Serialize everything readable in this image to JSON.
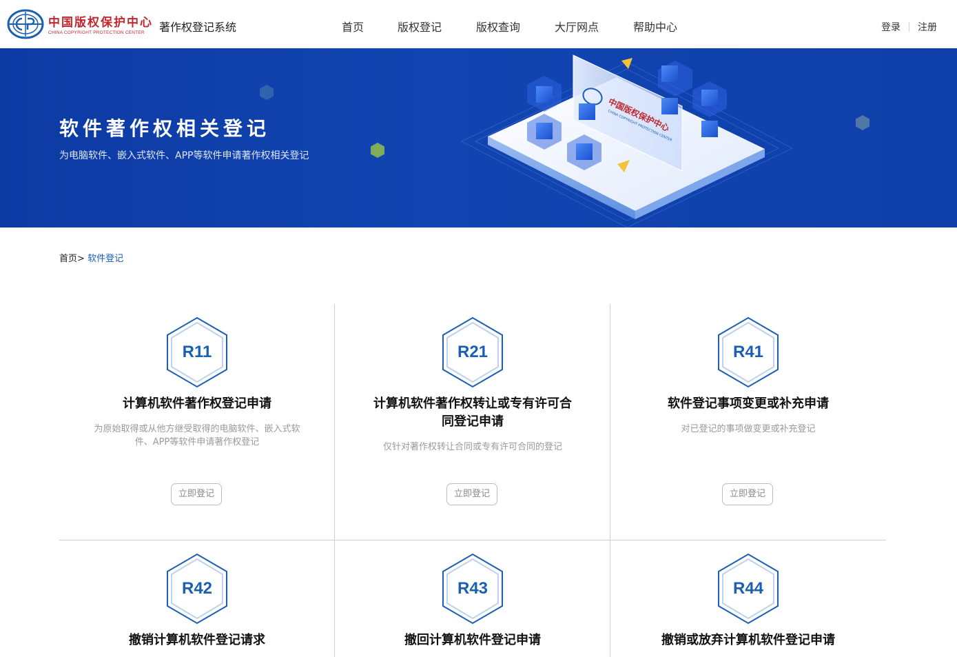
{
  "header": {
    "logo_cn": "中国版权保护中心",
    "logo_en": "CHINA COPYRIGHT PROTECTION CENTER",
    "system_name": "著作权登记系统",
    "nav": [
      "首页",
      "版权登记",
      "版权查询",
      "大厅网点",
      "帮助中心"
    ],
    "login": "登录",
    "register": "注册"
  },
  "banner": {
    "title": "软件著作权相关登记",
    "subtitle": "为电脑软件、嵌入式软件、APP等软件申请著作权相关登记",
    "art_logo_cn": "中国版权保护中心",
    "art_logo_en": "CHINA COPYRIGHT PROTECTION CENTER"
  },
  "breadcrumb": {
    "home": "首页",
    "separator": ">",
    "current": "软件登记"
  },
  "cards": [
    {
      "code": "R11",
      "title": "计算机软件著作权登记申请",
      "desc": "为原始取得或从他方继受取得的电脑软件、嵌入式软件、APP等软件申请著作权登记",
      "button": "立即登记"
    },
    {
      "code": "R21",
      "title": "计算机软件著作权转让或专有许可合同登记申请",
      "desc": "仅针对著作权转让合同或专有许可合同的登记",
      "button": "立即登记"
    },
    {
      "code": "R41",
      "title": "软件登记事项变更或补充申请",
      "desc": "对已登记的事项做变更或补充登记",
      "button": "立即登记"
    },
    {
      "code": "R42",
      "title": "撤销计算机软件登记请求"
    },
    {
      "code": "R43",
      "title": "撤回计算机软件登记申请"
    },
    {
      "code": "R44",
      "title": "撤销或放弃计算机软件登记申请"
    }
  ],
  "colors": {
    "banner": "#1245b2",
    "accent": "#1a5fb4",
    "logo_red": "#c1272d"
  }
}
